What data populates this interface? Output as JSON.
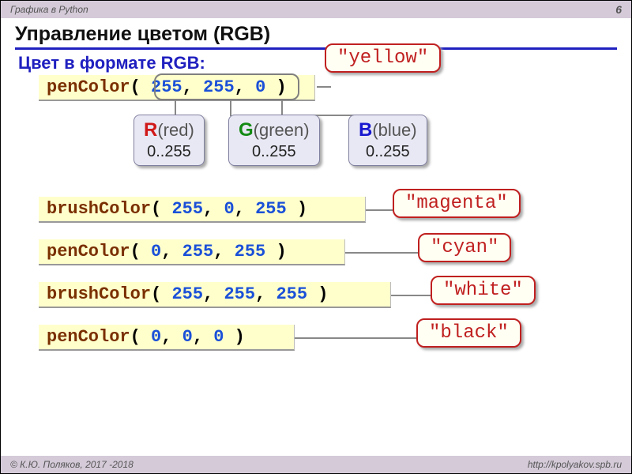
{
  "header": {
    "left": "Графика в Python",
    "page": "6"
  },
  "title": "Управление цветом (RGB)",
  "subtitle": "Цвет в формате RGB:",
  "yellow_label": "\"yellow\"",
  "code1": {
    "fn": "penColor",
    "r": "255",
    "g": "255",
    "b": "0"
  },
  "legend": {
    "r": {
      "letter": "R",
      "word": "(red)",
      "range": "0..255"
    },
    "g": {
      "letter": "G",
      "word": "(green)",
      "range": "0..255"
    },
    "b": {
      "letter": "B",
      "word": "(blue)",
      "range": "0..255"
    }
  },
  "rows": [
    {
      "fn": "brushColor",
      "r": "255",
      "g": "0",
      "b": "255",
      "label": "\"magenta\""
    },
    {
      "fn": "penColor",
      "r": "0",
      "g": "255",
      "b": "255",
      "label": "\"cyan\""
    },
    {
      "fn": "brushColor",
      "r": "255",
      "g": "255",
      "b": "255",
      "label": "\"white\""
    },
    {
      "fn": "penColor",
      "r": "0",
      "g": "0",
      "b": "0",
      "label": "\"black\""
    }
  ],
  "footer": {
    "left": "© К.Ю. Поляков, 2017 -2018",
    "right": "http://kpolyakov.spb.ru"
  }
}
